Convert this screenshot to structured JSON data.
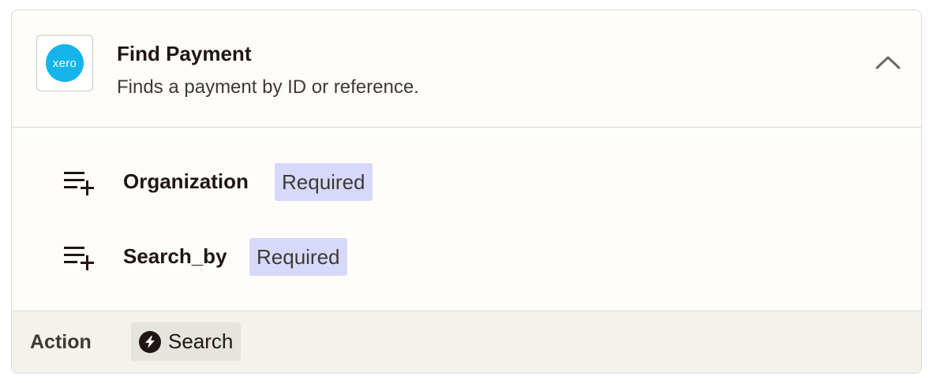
{
  "step": {
    "app_logo_text": "xero",
    "title": "Find Payment",
    "subtitle": "Finds a payment by ID or reference.",
    "collapse_icon": "chevron-up-icon"
  },
  "fields": [
    {
      "label": "Organization",
      "badge": "Required",
      "icon": "playlist-add-icon"
    },
    {
      "label": "Search_by",
      "badge": "Required",
      "icon": "playlist-add-icon"
    }
  ],
  "footer": {
    "label": "Action",
    "chip_label": "Search",
    "chip_icon": "bolt-icon"
  },
  "colors": {
    "xero_brand": "#13b5ea",
    "badge_bg": "#d8d8fb",
    "footer_bg": "#f3f2ec"
  }
}
